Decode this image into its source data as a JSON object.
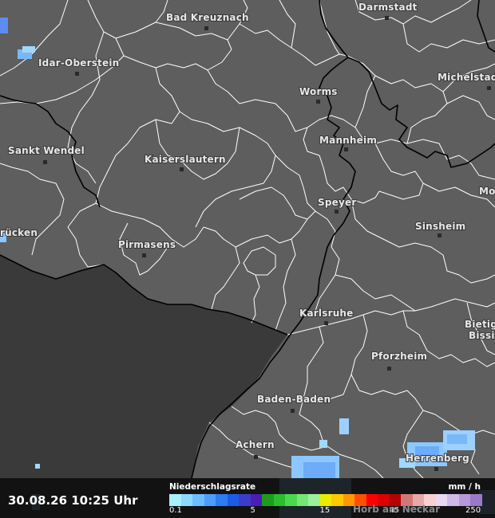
{
  "timestamp": "30.08.26 10:25 Uhr",
  "legend": {
    "title": "Niederschlagsrate",
    "unit": "mm / h",
    "ticks": [
      {
        "label": "0.1",
        "index": 0
      },
      {
        "label": "5",
        "index": 7
      },
      {
        "label": "15",
        "index": 13
      },
      {
        "label": "45",
        "index": 19
      },
      {
        "label": "250",
        "index": 26
      }
    ],
    "colors": [
      "#a8f0ff",
      "#8cd8ff",
      "#6cbcff",
      "#4c9cff",
      "#2c7cf4",
      "#1c5ce4",
      "#3c3ccc",
      "#4c1cb4",
      "#1c9c1c",
      "#2cbc2c",
      "#4cd84c",
      "#74e874",
      "#9cf09c",
      "#ecec00",
      "#ffc800",
      "#ff9800",
      "#ff5000",
      "#ff0000",
      "#dc0000",
      "#b40000",
      "#d07878",
      "#e8a8a8",
      "#f8d0d0",
      "#e8d8f0",
      "#d0b8e8",
      "#b898d8",
      "#9c78c8"
    ]
  },
  "cities": [
    {
      "name": "Bad Kreuznach"
    },
    {
      "name": "Darmstadt"
    },
    {
      "name": "Idar-Oberstein"
    },
    {
      "name": "Michelstadt"
    },
    {
      "name": "Worms"
    },
    {
      "name": "Sankt Wendel"
    },
    {
      "name": "Mannheim"
    },
    {
      "name": "Kaiserslautern"
    },
    {
      "name": "Mo"
    },
    {
      "name": "Speyer"
    },
    {
      "name": "rücken"
    },
    {
      "name": "Sinsheim"
    },
    {
      "name": "Pirmasens"
    },
    {
      "name": "Karlsruhe"
    },
    {
      "name": "Bietig"
    },
    {
      "name": "Bissi"
    },
    {
      "name": "Pforzheim"
    },
    {
      "name": "Baden-Baden"
    },
    {
      "name": "Achern"
    },
    {
      "name": "Herrenberg"
    },
    {
      "name": "Horb am Neckar"
    }
  ]
}
